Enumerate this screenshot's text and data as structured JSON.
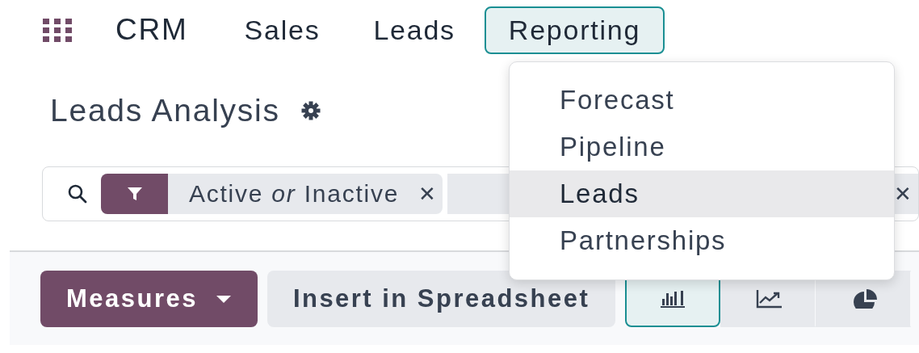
{
  "nav": {
    "app": "CRM",
    "items": [
      {
        "label": "Sales",
        "selected": false
      },
      {
        "label": "Leads",
        "selected": false
      },
      {
        "label": "Reporting",
        "selected": true
      }
    ]
  },
  "dropdown": {
    "items": [
      {
        "label": "Forecast",
        "highlighted": false
      },
      {
        "label": "Pipeline",
        "highlighted": false
      },
      {
        "label": "Leads",
        "highlighted": true
      },
      {
        "label": "Partnerships",
        "highlighted": false
      }
    ]
  },
  "page_title": "Leads Analysis",
  "search": {
    "facets": [
      {
        "label": "Active *or* Inactive",
        "remove": "✕"
      },
      {
        "remove": "✕"
      }
    ]
  },
  "toolbar": {
    "measures": "Measures",
    "insert": "Insert in Spreadsheet",
    "views": [
      {
        "kind": "bar",
        "selected": true
      },
      {
        "kind": "line",
        "selected": false
      },
      {
        "kind": "pie",
        "selected": false
      }
    ]
  }
}
